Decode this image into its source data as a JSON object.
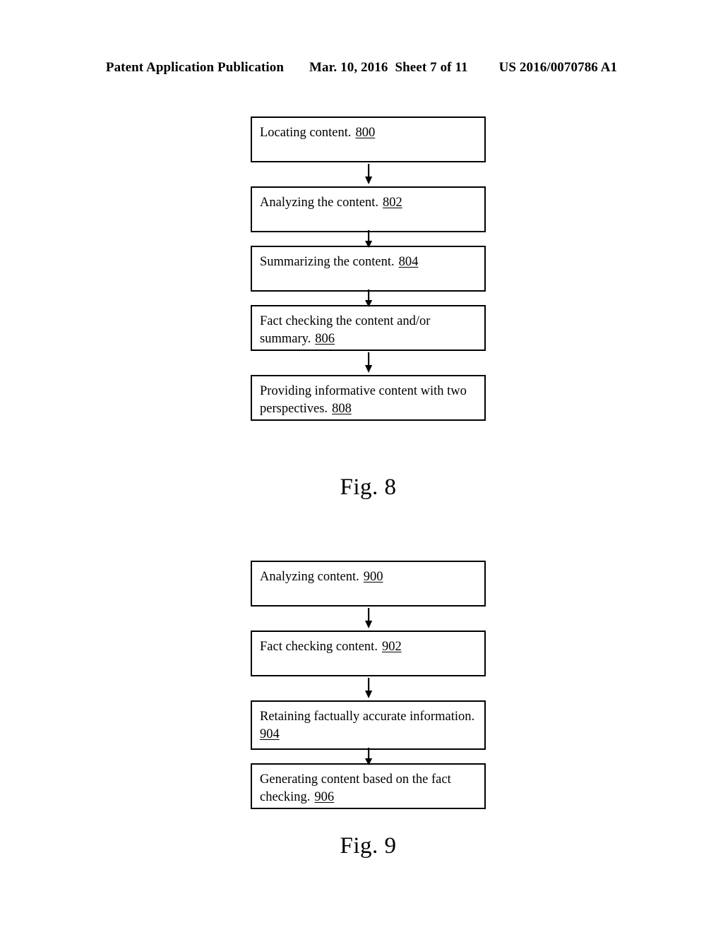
{
  "header": {
    "publication": "Patent Application Publication",
    "date": "Mar. 10, 2016",
    "sheet": "Sheet 7 of 11",
    "patent_number": "US 2016/0070786 A1"
  },
  "figures": [
    {
      "id": "figure-8",
      "caption": "Fig. 8",
      "steps": [
        {
          "lines": [
            "Locating content."
          ],
          "ref": "800"
        },
        {
          "lines": [
            "Analyzing the content."
          ],
          "ref": "802"
        },
        {
          "lines": [
            "Summarizing the content."
          ],
          "ref": "804"
        },
        {
          "lines": [
            "Fact checking the content and/or",
            "summary."
          ],
          "ref": "806"
        },
        {
          "lines": [
            "Providing informative content with two",
            "perspectives."
          ],
          "ref": "808"
        }
      ]
    },
    {
      "id": "figure-9",
      "caption": "Fig. 9",
      "steps": [
        {
          "lines": [
            "Analyzing content."
          ],
          "ref": "900"
        },
        {
          "lines": [
            "Fact checking content."
          ],
          "ref": "902"
        },
        {
          "lines": [
            "Retaining factually accurate information."
          ],
          "ref": "904"
        },
        {
          "lines": [
            "Generating content based on the fact",
            "checking."
          ],
          "ref": "906"
        }
      ]
    }
  ],
  "arrow_icon": "arrow-down-icon"
}
